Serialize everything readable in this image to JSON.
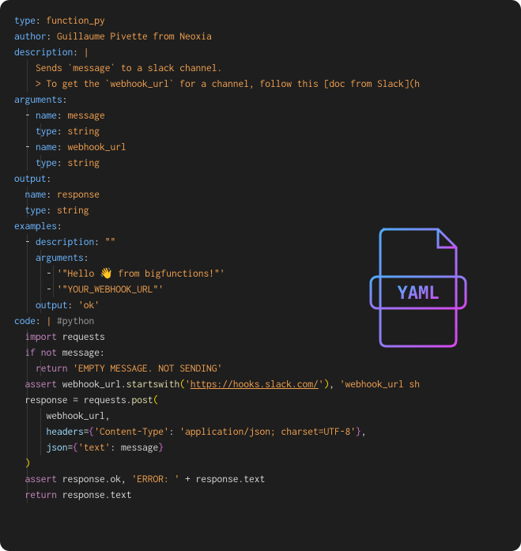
{
  "icon_label": "YAML",
  "lines": [
    {
      "indent": 0,
      "tokens": [
        {
          "t": "type",
          "c": "key"
        },
        {
          "t": ": ",
          "c": "punc"
        },
        {
          "t": "function_py",
          "c": "str"
        }
      ]
    },
    {
      "indent": 0,
      "tokens": [
        {
          "t": "author",
          "c": "key"
        },
        {
          "t": ": ",
          "c": "punc"
        },
        {
          "t": "Guillaume Pivette from Neoxia",
          "c": "str"
        }
      ]
    },
    {
      "indent": 0,
      "tokens": [
        {
          "t": "description",
          "c": "key"
        },
        {
          "t": ": ",
          "c": "punc"
        },
        {
          "t": "|",
          "c": "str"
        }
      ]
    },
    {
      "indent": 2,
      "guides": [
        1
      ],
      "tokens": [
        {
          "t": "Sends `message` to a slack channel.",
          "c": "str"
        }
      ]
    },
    {
      "indent": 0,
      "guides": [
        1
      ],
      "tokens": [
        {
          "t": "",
          "c": "text"
        }
      ]
    },
    {
      "indent": 2,
      "guides": [
        1
      ],
      "tokens": [
        {
          "t": "> To get the `webhook_url` for a channel, follow this [doc from Slack](h",
          "c": "str"
        }
      ]
    },
    {
      "indent": 0,
      "tokens": [
        {
          "t": "arguments",
          "c": "key"
        },
        {
          "t": ":",
          "c": "punc"
        }
      ]
    },
    {
      "indent": 1,
      "guides": [
        1
      ],
      "tokens": [
        {
          "t": "- ",
          "c": "punc"
        },
        {
          "t": "name",
          "c": "key"
        },
        {
          "t": ": ",
          "c": "punc"
        },
        {
          "t": "message",
          "c": "str"
        }
      ]
    },
    {
      "indent": 2,
      "guides": [
        1,
        2
      ],
      "tokens": [
        {
          "t": "type",
          "c": "key"
        },
        {
          "t": ": ",
          "c": "punc"
        },
        {
          "t": "string",
          "c": "str"
        }
      ]
    },
    {
      "indent": 1,
      "guides": [
        1
      ],
      "tokens": [
        {
          "t": "- ",
          "c": "punc"
        },
        {
          "t": "name",
          "c": "key"
        },
        {
          "t": ": ",
          "c": "punc"
        },
        {
          "t": "webhook_url",
          "c": "str"
        }
      ]
    },
    {
      "indent": 2,
      "guides": [
        1,
        2
      ],
      "tokens": [
        {
          "t": "type",
          "c": "key"
        },
        {
          "t": ": ",
          "c": "punc"
        },
        {
          "t": "string",
          "c": "str"
        }
      ]
    },
    {
      "indent": 0,
      "tokens": [
        {
          "t": "output",
          "c": "key"
        },
        {
          "t": ":",
          "c": "punc"
        }
      ]
    },
    {
      "indent": 1,
      "guides": [
        1
      ],
      "tokens": [
        {
          "t": "name",
          "c": "key"
        },
        {
          "t": ": ",
          "c": "punc"
        },
        {
          "t": "response",
          "c": "str"
        }
      ]
    },
    {
      "indent": 1,
      "guides": [
        1
      ],
      "tokens": [
        {
          "t": "type",
          "c": "key"
        },
        {
          "t": ": ",
          "c": "punc"
        },
        {
          "t": "string",
          "c": "str"
        }
      ]
    },
    {
      "indent": 0,
      "tokens": [
        {
          "t": "examples",
          "c": "key"
        },
        {
          "t": ":",
          "c": "punc"
        }
      ]
    },
    {
      "indent": 1,
      "guides": [
        1
      ],
      "tokens": [
        {
          "t": "- ",
          "c": "punc"
        },
        {
          "t": "description",
          "c": "key"
        },
        {
          "t": ": ",
          "c": "punc"
        },
        {
          "t": "\"\"",
          "c": "str"
        }
      ]
    },
    {
      "indent": 2,
      "guides": [
        1,
        2
      ],
      "tokens": [
        {
          "t": "arguments",
          "c": "key"
        },
        {
          "t": ":",
          "c": "punc"
        }
      ]
    },
    {
      "indent": 3,
      "guides": [
        1,
        2,
        3
      ],
      "tokens": [
        {
          "t": "- ",
          "c": "punc"
        },
        {
          "t": "'\"Hello 👋 from bigfunctions!\"'",
          "c": "str"
        }
      ]
    },
    {
      "indent": 3,
      "guides": [
        1,
        2,
        3
      ],
      "tokens": [
        {
          "t": "- ",
          "c": "punc"
        },
        {
          "t": "'\"YOUR_WEBHOOK_URL\"'",
          "c": "str"
        }
      ]
    },
    {
      "indent": 2,
      "guides": [
        1,
        2
      ],
      "tokens": [
        {
          "t": "output",
          "c": "key"
        },
        {
          "t": ": ",
          "c": "punc"
        },
        {
          "t": "'ok'",
          "c": "str"
        }
      ]
    },
    {
      "indent": 0,
      "tokens": [
        {
          "t": "code",
          "c": "key"
        },
        {
          "t": ": ",
          "c": "punc"
        },
        {
          "t": "| ",
          "c": "str"
        },
        {
          "t": "#python",
          "c": "comment"
        }
      ]
    },
    {
      "indent": 1,
      "guides": [
        1
      ],
      "tokens": [
        {
          "t": "import",
          "c": "kw"
        },
        {
          "t": " requests",
          "c": "text"
        }
      ]
    },
    {
      "indent": 1,
      "guides": [
        1
      ],
      "tokens": [
        {
          "t": "if",
          "c": "kw"
        },
        {
          "t": " ",
          "c": "text"
        },
        {
          "t": "not",
          "c": "kw"
        },
        {
          "t": " message:",
          "c": "text"
        }
      ]
    },
    {
      "indent": 2,
      "guides": [
        1,
        2
      ],
      "tokens": [
        {
          "t": "return",
          "c": "kw"
        },
        {
          "t": " ",
          "c": "text"
        },
        {
          "t": "'EMPTY MESSAGE. NOT SENDING'",
          "c": "lit"
        }
      ]
    },
    {
      "indent": 1,
      "guides": [
        1
      ],
      "tokens": [
        {
          "t": "assert",
          "c": "kw"
        },
        {
          "t": " webhook_url.",
          "c": "text"
        },
        {
          "t": "startswith",
          "c": "fn"
        },
        {
          "t": "(",
          "c": "bracket1"
        },
        {
          "t": "'",
          "c": "lit"
        },
        {
          "t": "https://hooks.slack.com/",
          "c": "lit underline"
        },
        {
          "t": "'",
          "c": "lit"
        },
        {
          "t": ")",
          "c": "bracket1"
        },
        {
          "t": ", ",
          "c": "text"
        },
        {
          "t": "'webhook_url sh",
          "c": "lit"
        }
      ]
    },
    {
      "indent": 1,
      "guides": [
        1
      ],
      "tokens": [
        {
          "t": "response = requests.",
          "c": "text"
        },
        {
          "t": "post",
          "c": "fn"
        },
        {
          "t": "(",
          "c": "bracket1"
        }
      ]
    },
    {
      "indent": 3,
      "guides": [
        1,
        2
      ],
      "tokens": [
        {
          "t": "webhook_url,",
          "c": "text"
        }
      ]
    },
    {
      "indent": 3,
      "guides": [
        1,
        2
      ],
      "tokens": [
        {
          "t": "headers",
          "c": "pname"
        },
        {
          "t": "=",
          "c": "text"
        },
        {
          "t": "{",
          "c": "bracket2"
        },
        {
          "t": "'Content-Type'",
          "c": "lit"
        },
        {
          "t": ": ",
          "c": "text"
        },
        {
          "t": "'application/json; charset=UTF-8'",
          "c": "lit"
        },
        {
          "t": "}",
          "c": "bracket2"
        },
        {
          "t": ",",
          "c": "text"
        }
      ]
    },
    {
      "indent": 3,
      "guides": [
        1,
        2
      ],
      "tokens": [
        {
          "t": "json",
          "c": "pname"
        },
        {
          "t": "=",
          "c": "text"
        },
        {
          "t": "{",
          "c": "bracket2"
        },
        {
          "t": "'text'",
          "c": "lit"
        },
        {
          "t": ": message",
          "c": "text"
        },
        {
          "t": "}",
          "c": "bracket2"
        }
      ]
    },
    {
      "indent": 1,
      "guides": [
        1
      ],
      "tokens": [
        {
          "t": ")",
          "c": "bracket1"
        }
      ]
    },
    {
      "indent": 1,
      "guides": [
        1
      ],
      "tokens": [
        {
          "t": "assert",
          "c": "kw"
        },
        {
          "t": " response.ok, ",
          "c": "text"
        },
        {
          "t": "'ERROR: '",
          "c": "lit"
        },
        {
          "t": " + response.text",
          "c": "text"
        }
      ]
    },
    {
      "indent": 1,
      "guides": [
        1
      ],
      "tokens": [
        {
          "t": "return",
          "c": "kw"
        },
        {
          "t": " response.text",
          "c": "text"
        }
      ]
    }
  ]
}
